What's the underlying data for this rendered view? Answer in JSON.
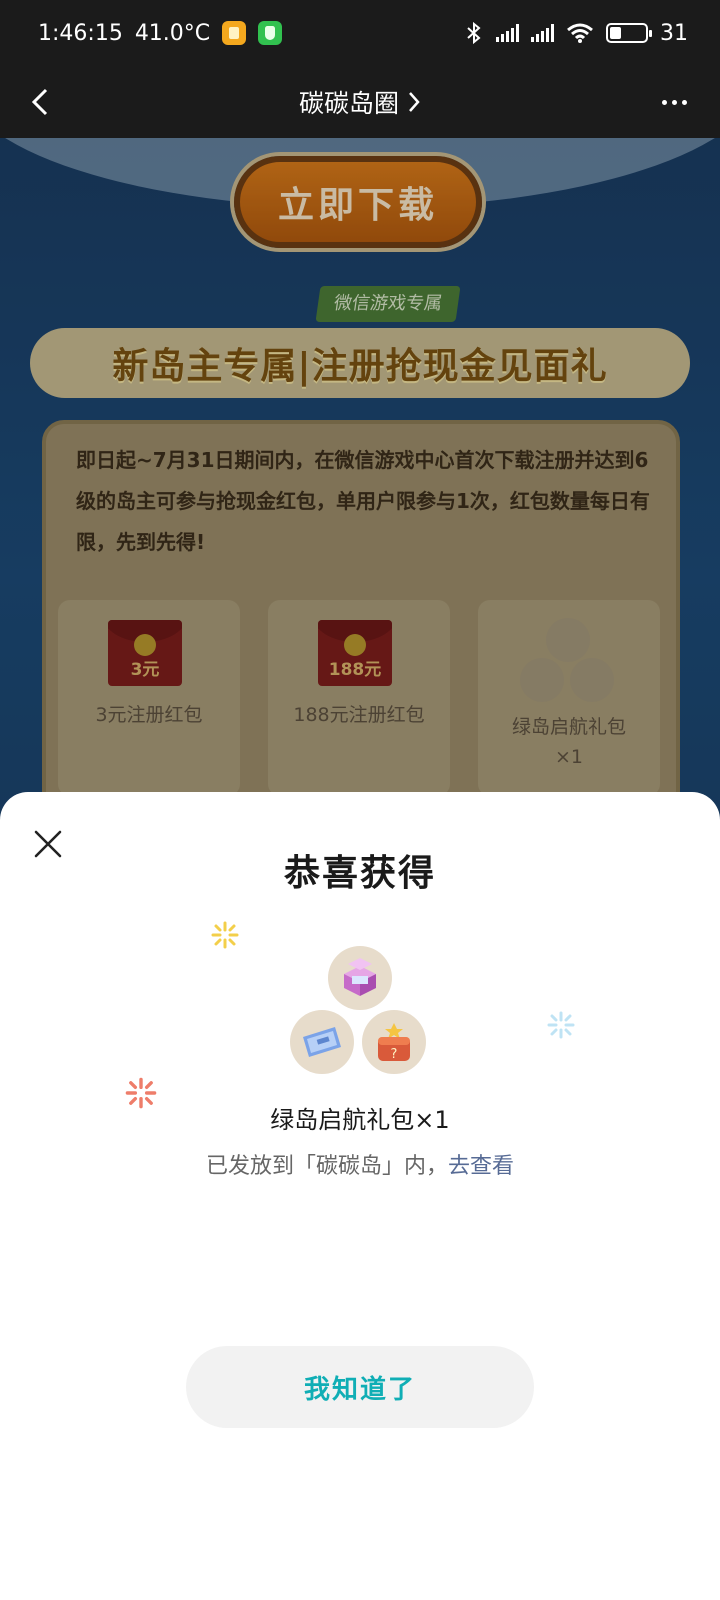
{
  "status_bar": {
    "time": "1:46:15",
    "temperature": "41.0°C",
    "battery_level": "31",
    "battery_fraction": 0.31,
    "icons": [
      "notes-app-icon",
      "security-app-icon",
      "bluetooth-icon",
      "signal-icon",
      "signal-icon",
      "wifi-icon",
      "battery-icon"
    ]
  },
  "nav": {
    "title": "碳碳岛圈",
    "back_icon": "chevron-left-icon",
    "more_icon": "more-dots-icon"
  },
  "background_page": {
    "download_button": "立即下载",
    "exclusive_tag": "微信游戏专属",
    "banner_title": "新岛主专属|注册抢现金见面礼",
    "rules_text": "即日起~7月31日期间内，在微信游戏中心首次下载注册并达到6级的岛主可参与抢现金红包，单用户限参与1次，红包数量每日有限，先到先得!",
    "rewards": [
      {
        "amount": "3元",
        "label": "3元注册红包"
      },
      {
        "amount": "188元",
        "label": "188元注册红包"
      },
      {
        "label": "绿岛启航礼包 ×1"
      }
    ]
  },
  "sheet": {
    "title": "恭喜获得",
    "gift_name": "绿岛启航礼包×1",
    "note_prefix": "已发放到「碳碳岛」内，",
    "note_link": "去查看",
    "confirm_button": "我知道了",
    "colors": {
      "link": "#576b95",
      "confirm_text": "#10aeb5",
      "sparkle_yellow": "#f3cf4a",
      "sparkle_blue": "#bfe3f4",
      "sparkle_red": "#ee7d6a"
    }
  }
}
